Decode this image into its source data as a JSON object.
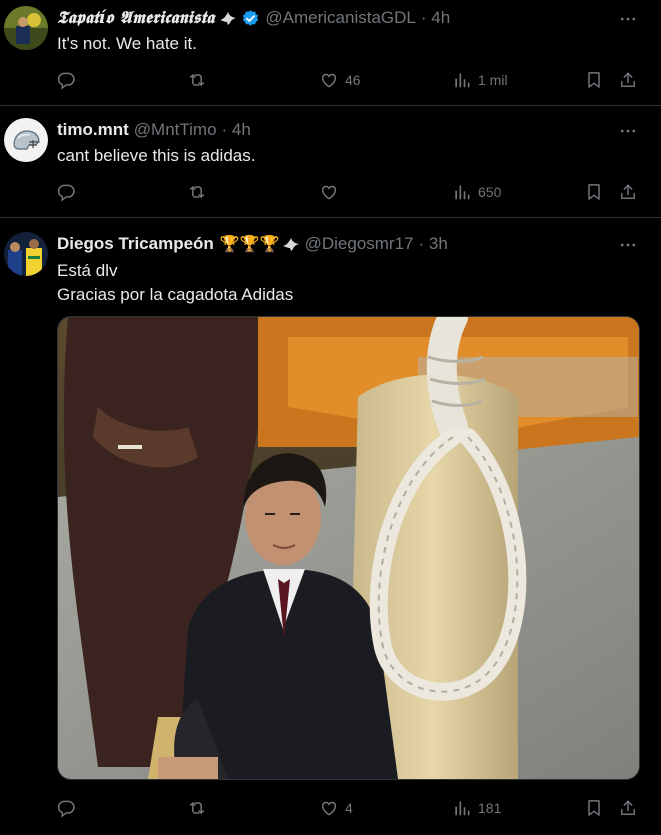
{
  "tweets": [
    {
      "name": "𝕿𝖆𝖕𝖆𝖙í𝖔 𝕬𝖒𝖊𝖗𝖎𝖈𝖆𝖓𝖎𝖘𝖙𝖆",
      "handle": "@AmericanistaGDL",
      "time": "· 4h",
      "text": "It's not. We hate it.",
      "likes": "46",
      "views": "1 mil"
    },
    {
      "name": "timo.mnt",
      "handle": "@MntTimo",
      "time": "· 4h",
      "text": "cant believe this is adidas.",
      "likes": "",
      "views": "650"
    },
    {
      "name": "Diegos Tricampeón",
      "name_emoji": "🏆🏆🏆",
      "handle": "@Diegosmr17",
      "time": "· 3h",
      "text_line1": "Está dlv",
      "text_line2": "Gracias por la cagadota Adidas",
      "likes": "4",
      "views": "181"
    }
  ],
  "icons": {
    "reply": "reply-icon",
    "repost": "repost-icon",
    "like": "heart-icon",
    "views": "views-icon",
    "bookmark": "bookmark-icon",
    "share": "share-icon",
    "more": "more-icon",
    "verified": "verified-badge-icon"
  },
  "colors": {
    "background": "#000000",
    "text": "#e7e9ea",
    "muted": "#71767b",
    "border": "#2f3336",
    "verified": "#1d9bf0"
  }
}
